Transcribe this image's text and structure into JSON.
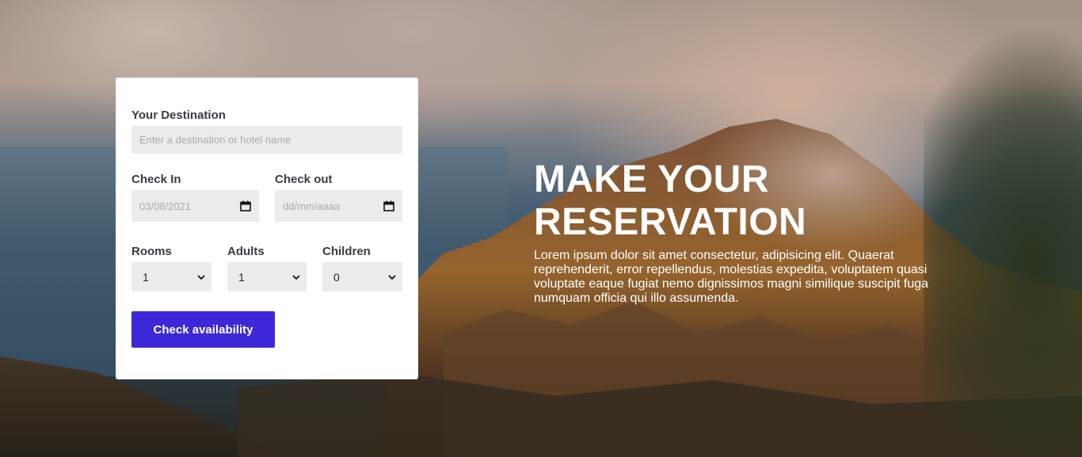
{
  "booking": {
    "destination": {
      "label": "Your Destination",
      "placeholder": "Enter a destination or hotel name",
      "value": ""
    },
    "check_in": {
      "label": "Check In",
      "value": "03/08/2021",
      "icon": "calendar-icon"
    },
    "check_out": {
      "label": "Check out",
      "value": "dd/mm/aaaa",
      "icon": "calendar-icon"
    },
    "rooms": {
      "label": "Rooms",
      "selected": "1",
      "icon": "chevron-down-icon"
    },
    "adults": {
      "label": "Adults",
      "selected": "1",
      "icon": "chevron-down-icon"
    },
    "children": {
      "label": "Children",
      "selected": "0",
      "icon": "chevron-down-icon"
    },
    "submit_label": "Check availability"
  },
  "hero": {
    "title": "MAKE YOUR RESERVATION",
    "description": "Lorem ipsum dolor sit amet consectetur, adipisicing elit. Quaerat reprehenderit, error repellendus, molestias expedita, voluptatem quasi voluptate eaque fugiat nemo dignissimos magni similique suscipit fuga numquam officia qui illo assumenda."
  },
  "colors": {
    "accent": "#3e27d8",
    "card_background": "#ffffff",
    "input_background": "#ebebed",
    "label_text": "#3a3a4a",
    "hero_text": "#ffffff"
  }
}
